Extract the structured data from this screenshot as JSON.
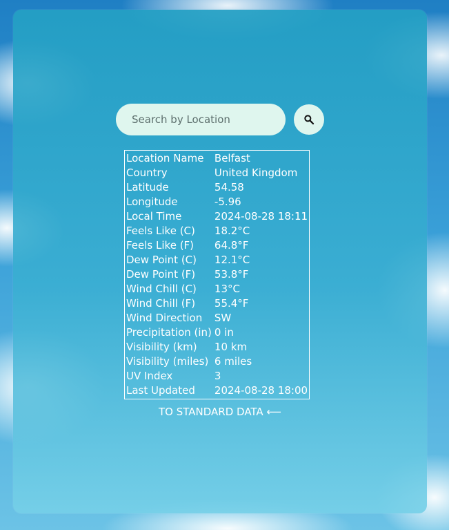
{
  "search": {
    "placeholder": "Search by Location",
    "button_icon": "search-icon"
  },
  "weather": {
    "rows": [
      {
        "label": "Location Name",
        "value": "Belfast"
      },
      {
        "label": "Country",
        "value": "United Kingdom"
      },
      {
        "label": "Latitude",
        "value": "54.58"
      },
      {
        "label": "Longitude",
        "value": "-5.96"
      },
      {
        "label": "Local Time",
        "value": "2024-08-28 18:11"
      },
      {
        "label": "Feels Like (C)",
        "value": "18.2°C"
      },
      {
        "label": "Feels Like (F)",
        "value": "64.8°F"
      },
      {
        "label": "Dew Point (C)",
        "value": "12.1°C"
      },
      {
        "label": "Dew Point (F)",
        "value": "53.8°F"
      },
      {
        "label": "Wind Chill (C)",
        "value": "13°C"
      },
      {
        "label": "Wind Chill (F)",
        "value": "55.4°F"
      },
      {
        "label": "Wind Direction",
        "value": "SW"
      },
      {
        "label": "Precipitation (in)",
        "value": "0 in"
      },
      {
        "label": "Visibility (km)",
        "value": "10 km"
      },
      {
        "label": "Visibility (miles)",
        "value": "6 miles"
      },
      {
        "label": "UV Index",
        "value": "3"
      },
      {
        "label": "Last Updated",
        "value": "2024-08-28 18:00"
      }
    ]
  },
  "toggle": {
    "label": "TO STANDARD DATA ⟵"
  },
  "colors": {
    "panel": "#24a0c4",
    "input_bg": "#dff6ee",
    "text": "#ffffff"
  }
}
